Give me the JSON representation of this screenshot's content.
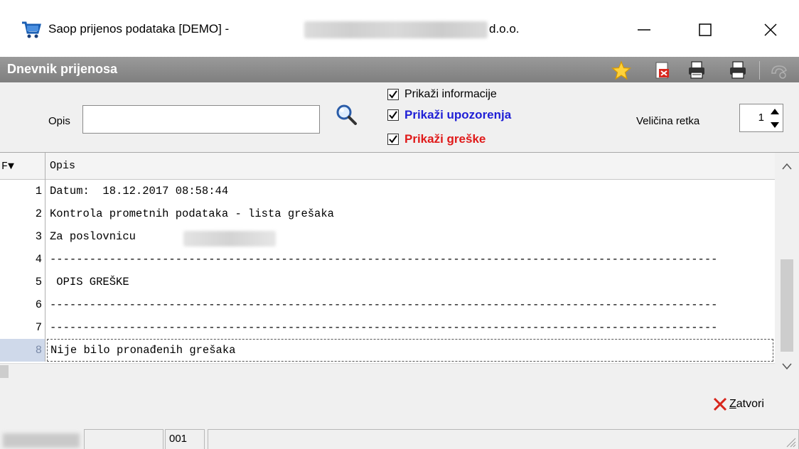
{
  "window": {
    "title_prefix": "Saop prijenos podataka [DEMO] -",
    "title_suffix": "d.o.o.",
    "minimize": "—",
    "maximize": "☐",
    "close": "✕"
  },
  "panel": {
    "title": "Dnevnik prijenosa",
    "toolbar_icons": [
      "star-icon",
      "export-file-icon",
      "print-preview-icon",
      "print-icon",
      "help-icon"
    ]
  },
  "filter": {
    "opis_label": "Opis",
    "opis_value": "",
    "checkboxes": [
      {
        "label": "Prikaži informacije",
        "checked": true,
        "color": "#000000"
      },
      {
        "label": "Prikaži upozorenja",
        "checked": true,
        "color": "#1f1fd6"
      },
      {
        "label": "Prikaži greške",
        "checked": true,
        "color": "#e01a1a"
      }
    ],
    "row_size_label": "Veličina retka",
    "row_size_value": "1"
  },
  "grid": {
    "columns": [
      "F▼",
      "Opis"
    ],
    "rows": [
      {
        "num": "1",
        "text": "Datum:  18.12.2017 08:58:44"
      },
      {
        "num": "2",
        "text": "Kontrola prometnih podataka - lista grešaka"
      },
      {
        "num": "3",
        "text": "Za poslovnicu"
      },
      {
        "num": "4",
        "text": "-----------------------------------------------------------------------------------------------------"
      },
      {
        "num": "5",
        "text": " OPIS GREŠKE"
      },
      {
        "num": "6",
        "text": "-----------------------------------------------------------------------------------------------------"
      },
      {
        "num": "7",
        "text": "-----------------------------------------------------------------------------------------------------"
      },
      {
        "num": "8",
        "text": "Nije bilo pronađenih grešaka"
      }
    ],
    "selected_row": 8
  },
  "footer": {
    "close_accel": "Z",
    "close_rest": "atvori"
  },
  "statusbar": {
    "cell2": "",
    "cell3": "001",
    "cell4": ""
  }
}
